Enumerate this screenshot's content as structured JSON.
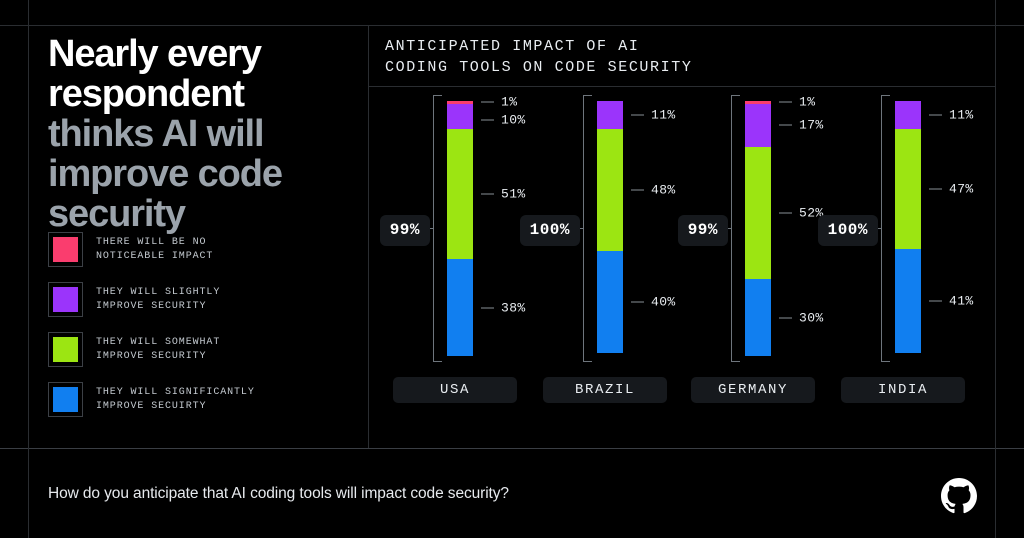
{
  "headline": {
    "line_white": "Nearly every respondent",
    "line_gray": "thinks AI will improve code security"
  },
  "legend": {
    "items": [
      {
        "label": "THERE WILL BE NO\nNOTICEABLE IMPACT",
        "color": "#fa3d6e"
      },
      {
        "label": "THEY WILL SLIGHTLY\nIMPROVE SECURITY",
        "color": "#9b34fb"
      },
      {
        "label": "THEY WILL SOMEWHAT\nIMPROVE SECURITY",
        "color": "#9ce512"
      },
      {
        "label": "THEY WILL SIGNIFICANTLY\nIMPROVE SECUIRTY",
        "color": "#117ff0"
      }
    ]
  },
  "chart": {
    "title": "ANTICIPATED IMPACT OF AI\nCODING TOOLS ON CODE SECURITY"
  },
  "footer": {
    "question": "How do you anticipate that AI coding tools will impact code security?",
    "logo": "github-logo"
  },
  "chart_data": {
    "type": "bar",
    "title": "ANTICIPATED IMPACT OF AI CODING TOOLS ON CODE SECURITY",
    "subtitle": "How do you anticipate that AI coding tools will impact code security?",
    "stacked": true,
    "orientation": "vertical",
    "xlabel": "",
    "ylabel": "",
    "ylim": [
      0,
      100
    ],
    "grid": false,
    "legend_position": "left-panel",
    "categories": [
      "USA",
      "BRAZIL",
      "GERMANY",
      "INDIA"
    ],
    "series": [
      {
        "name": "THERE WILL BE NO NOTICEABLE IMPACT",
        "color": "#fa3d6e",
        "values": [
          1,
          0,
          1,
          0
        ]
      },
      {
        "name": "THEY WILL SLIGHTLY IMPROVE SECURITY",
        "color": "#9b34fb",
        "values": [
          10,
          11,
          17,
          11
        ]
      },
      {
        "name": "THEY WILL SOMEWHAT IMPROVE SECURITY",
        "color": "#9ce512",
        "values": [
          51,
          48,
          52,
          47
        ]
      },
      {
        "name": "THEY WILL SIGNIFICANTLY IMPROVE SECUIRTY",
        "color": "#117ff0",
        "values": [
          38,
          40,
          30,
          41
        ]
      }
    ],
    "annotations": {
      "totals": [
        "99%",
        "100%",
        "99%",
        "100%"
      ],
      "totals_description": "Bracketed total of respondents expecting improved security"
    },
    "columns": [
      {
        "country": "USA",
        "total": "99%",
        "segments": [
          {
            "label": "1%",
            "value": 1,
            "color": "#fa3d6e",
            "show_label": true
          },
          {
            "label": "10%",
            "value": 10,
            "color": "#9b34fb",
            "show_label": true
          },
          {
            "label": "51%",
            "value": 51,
            "color": "#9ce512",
            "show_label": true
          },
          {
            "label": "38%",
            "value": 38,
            "color": "#117ff0",
            "show_label": true
          }
        ]
      },
      {
        "country": "BRAZIL",
        "total": "100%",
        "segments": [
          {
            "label": "11%",
            "value": 11,
            "color": "#9b34fb",
            "show_label": true
          },
          {
            "label": "48%",
            "value": 48,
            "color": "#9ce512",
            "show_label": true
          },
          {
            "label": "40%",
            "value": 40,
            "color": "#117ff0",
            "show_label": true
          }
        ]
      },
      {
        "country": "GERMANY",
        "total": "99%",
        "segments": [
          {
            "label": "1%",
            "value": 1,
            "color": "#fa3d6e",
            "show_label": true
          },
          {
            "label": "17%",
            "value": 17,
            "color": "#9b34fb",
            "show_label": true
          },
          {
            "label": "52%",
            "value": 52,
            "color": "#9ce512",
            "show_label": true
          },
          {
            "label": "30%",
            "value": 30,
            "color": "#117ff0",
            "show_label": true
          }
        ]
      },
      {
        "country": "INDIA",
        "total": "100%",
        "segments": [
          {
            "label": "11%",
            "value": 11,
            "color": "#9b34fb",
            "show_label": true
          },
          {
            "label": "47%",
            "value": 47,
            "color": "#9ce512",
            "show_label": true
          },
          {
            "label": "41%",
            "value": 41,
            "color": "#117ff0",
            "show_label": true
          }
        ]
      }
    ]
  }
}
